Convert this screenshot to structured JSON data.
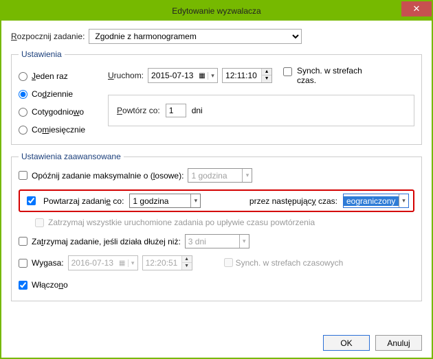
{
  "window": {
    "title": "Edytowanie wyzwalacza"
  },
  "beginTask": {
    "label": "Rozpocznij zadanie:",
    "value": "Zgodnie z harmonogramem"
  },
  "settings": {
    "legend": "Ustawienia",
    "radios": {
      "once": "Jeden raz",
      "daily": "Codziennie",
      "weekly": "Cotygodniowo",
      "monthly": "Comiesięcznie"
    },
    "launch": {
      "label": "Uruchom:",
      "date": "2015-07-13",
      "time": "12:11:10",
      "tz": "Synch. w strefach czas."
    },
    "repeat": {
      "label": "Powtórz co:",
      "value": "1",
      "unit": "dni"
    }
  },
  "advanced": {
    "legend": "Ustawienia zaawansowane",
    "delay": {
      "label": "Opóźnij zadanie maksymalnie o (losowe):",
      "value": "1 godzina"
    },
    "repeatTask": {
      "label": "Powtarzaj zadanie co:",
      "interval": "1 godzina",
      "durationLabel": "przez następujący czas:",
      "duration": "eograniczony"
    },
    "stopAtEnd": "Zatrzymaj wszystkie uruchomione zadania po upływie czasu powtórzenia",
    "stopIfLonger": {
      "label": "Zatrzymaj zadanie, jeśli działa dłużej niż:",
      "value": "3 dni"
    },
    "expire": {
      "label": "Wygasa:",
      "date": "2016-07-13",
      "time": "12:20:51",
      "tz": "Synch. w strefach czasowych"
    },
    "enabled": "Włączono"
  },
  "buttons": {
    "ok": "OK",
    "cancel": "Anuluj"
  }
}
